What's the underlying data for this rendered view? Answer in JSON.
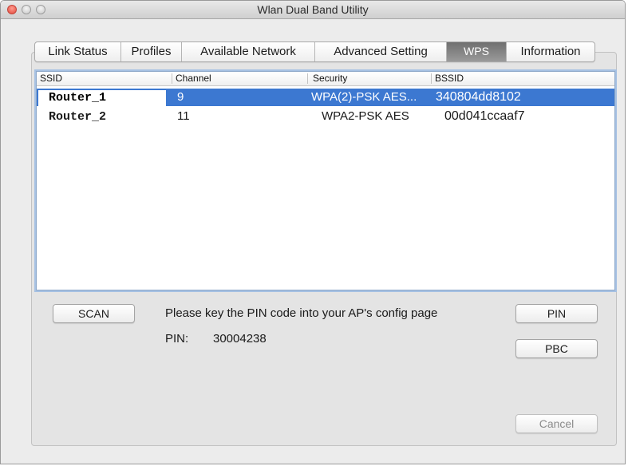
{
  "window": {
    "title": "Wlan Dual Band Utility"
  },
  "tabs": [
    {
      "label": "Link Status",
      "active": false
    },
    {
      "label": "Profiles",
      "active": false
    },
    {
      "label": "Available Network",
      "active": false
    },
    {
      "label": "Advanced Setting",
      "active": false
    },
    {
      "label": "WPS",
      "active": true
    },
    {
      "label": "Information",
      "active": false
    }
  ],
  "network_list": {
    "columns": [
      "SSID",
      "Channel",
      "Security",
      "BSSID"
    ],
    "rows": [
      {
        "ssid": "Router_1",
        "channel": "9",
        "security": "WPA(2)-PSK AES...",
        "bssid": "340804dd8102",
        "selected": true
      },
      {
        "ssid": "Router_2",
        "channel": "11",
        "security": "WPA2-PSK AES",
        "bssid": "00d041ccaaf7",
        "selected": false
      }
    ]
  },
  "wps": {
    "scan_label": "SCAN",
    "instruction": "Please key the PIN code into your AP's config page",
    "pin_label": "PIN:",
    "pin_value": "30004238",
    "pin_button": "PIN",
    "pbc_button": "PBC",
    "cancel_button": "Cancel"
  },
  "colors": {
    "selection": "#3c78d1",
    "active_tab": "#7f7f7f",
    "close_light": "#e2483b"
  }
}
